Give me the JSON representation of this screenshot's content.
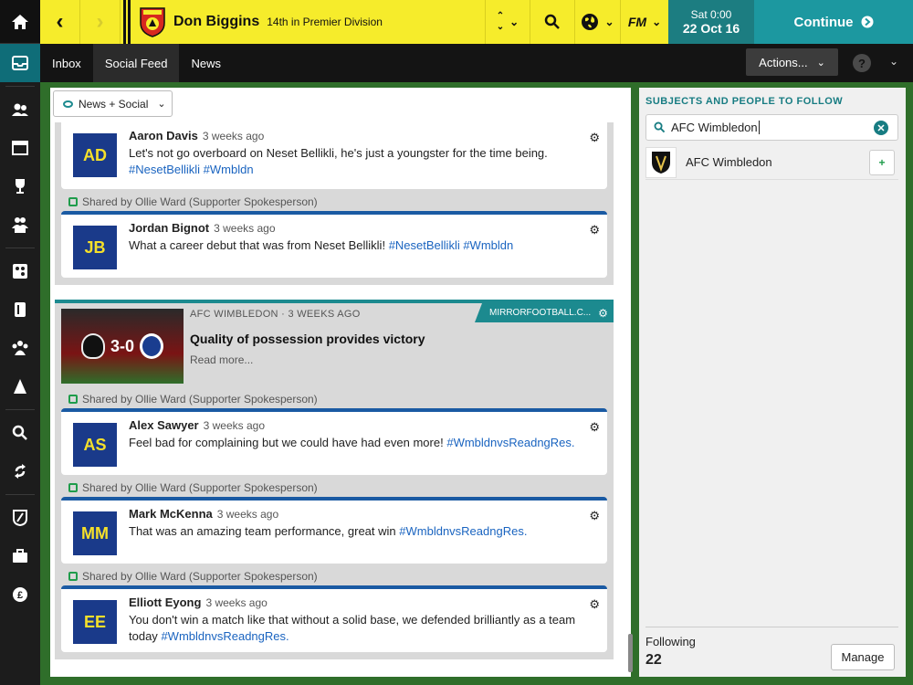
{
  "header": {
    "club_name": "Don Biggins",
    "club_position": "14th in Premier Division",
    "date_day": "Sat 0:00",
    "date_full": "22 Oct 16",
    "continue_label": "Continue",
    "fm_label": "FM"
  },
  "tabs": [
    {
      "label": "Inbox"
    },
    {
      "label": "Social Feed"
    },
    {
      "label": "News"
    }
  ],
  "actions_label": "Actions...",
  "filter_label": "News + Social",
  "feed": {
    "shared_label": "Shared by Ollie Ward (Supporter Spokesperson)",
    "posts": [
      {
        "initials": "AD",
        "author": "Aaron Davis",
        "ago": "3 weeks ago",
        "text": "Let's not go overboard on Neset Bellikli, he's just a youngster for the time being.",
        "tags": "#NesetBellikli #Wmbldn"
      },
      {
        "initials": "JB",
        "author": "Jordan Bignot",
        "ago": "3 weeks ago",
        "text": "What a career debut that was from Neset Bellikli!",
        "tags": "#NesetBellikli #Wmbldn"
      },
      {
        "initials": "AS",
        "author": "Alex Sawyer",
        "ago": "3 weeks ago",
        "text": "Feel bad for complaining but we could have had even more!",
        "tags": "#WmbldnvsReadngRes."
      },
      {
        "initials": "MM",
        "author": "Mark McKenna",
        "ago": "3 weeks ago",
        "text": "That was an amazing team performance, great win",
        "tags": "#WmbldnvsReadngRes."
      },
      {
        "initials": "EE",
        "author": "Elliott Eyong",
        "ago": "3 weeks ago",
        "text": "You don't win a match like that without a solid base, we defended brilliantly as a team today",
        "tags": "#WmbldnvsReadngRes."
      }
    ],
    "news": {
      "meta": "AFC WIMBLEDON · 3 WEEKS AGO",
      "source": "MIRRORFOOTBALL.C...",
      "score": "3-0",
      "title": "Quality of possession provides victory",
      "read_more": "Read more..."
    }
  },
  "right_panel": {
    "title": "SUBJECTS AND PEOPLE TO FOLLOW",
    "search_value": "AFC Wimbledon",
    "result_name": "AFC Wimbledon",
    "following_label": "Following",
    "following_count": "22",
    "manage_label": "Manage"
  },
  "colors": {
    "accent_yellow": "#f6ec2b",
    "teal": "#1c98a0",
    "hashtag_blue": "#1a64c0"
  }
}
